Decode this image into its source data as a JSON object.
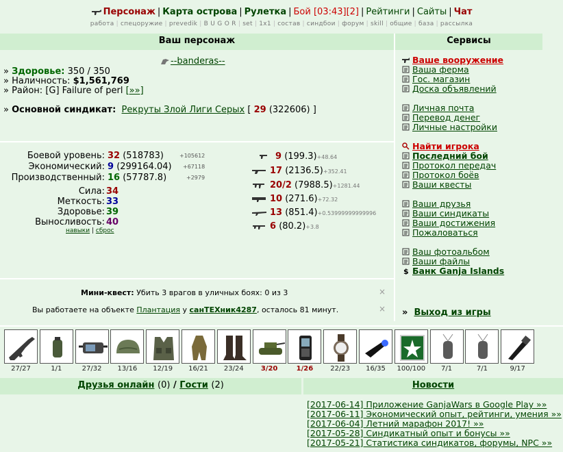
{
  "nav": {
    "items": [
      {
        "label": "Персонаж",
        "style": "red"
      },
      {
        "label": "Карта острова",
        "style": "normal"
      },
      {
        "label": "Рулетка",
        "style": "normal"
      },
      {
        "label": "Бой [03:43][2]",
        "style": "fight"
      },
      {
        "label": "Рейтинги",
        "style": "fightn"
      },
      {
        "label": "Сайты",
        "style": "fightn"
      },
      {
        "label": "Чат",
        "style": "red"
      }
    ],
    "sub": [
      "работа",
      "спецоружие",
      "prevedik",
      "B U G O R",
      "set",
      "1x1",
      "состав",
      "синдбои",
      "форум",
      "skill",
      "общие",
      "база",
      "рассылка"
    ]
  },
  "character": {
    "header": "Ваш персонаж",
    "nick": "--banderas--",
    "health_label": "Здоровье:",
    "health_value": "350 / 350",
    "cash_label": "Наличность:",
    "cash_value": "$1,561,769",
    "district_label": "Район:",
    "district_value": "[G] Failure of perl",
    "district_link": "[»»]",
    "syndicate_label": "Основной синдикат:",
    "syndicate_name": "Рекруты Злой Лиги Серых",
    "syndicate_open": "[",
    "syndicate_level": "29",
    "syndicate_points": "(322606)",
    "syndicate_close": "]"
  },
  "levels": [
    {
      "label": "Боевой уровень:",
      "value": "32",
      "extra": "(518783)",
      "delta": "+105612",
      "color": "red"
    },
    {
      "label": "Экономический:",
      "value": "9",
      "extra": "(299164.04)",
      "delta": "+67118",
      "color": "blue"
    },
    {
      "label": "Производственный:",
      "value": "16",
      "extra": "(57787.8)",
      "delta": "+2979",
      "color": "green"
    }
  ],
  "attributes": [
    {
      "label": "Сила:",
      "value": "34",
      "color": "red"
    },
    {
      "label": "Меткость:",
      "value": "33",
      "color": "blue"
    },
    {
      "label": "Здоровье:",
      "value": "39",
      "color": "green"
    },
    {
      "label": "Выносливость:",
      "value": "40",
      "color": "purple"
    }
  ],
  "attr_links": {
    "skills": "навыки",
    "reset": "сброс"
  },
  "weapons": [
    {
      "icon": "pistol-icon",
      "level": "9",
      "exp": "(199.3)",
      "delta": "+48.64"
    },
    {
      "icon": "shotgun-icon",
      "level": "17",
      "exp": "(2136.5)",
      "delta": "+352.41"
    },
    {
      "icon": "smg-icon",
      "level": "20/2",
      "exp": "(7988.5)",
      "delta": "+1281.44"
    },
    {
      "icon": "launcher-icon",
      "level": "10",
      "exp": "(271.6)",
      "delta": "+72.32"
    },
    {
      "icon": "sniper-icon",
      "level": "13",
      "exp": "(851.4)",
      "delta": "+0.53999999999996"
    },
    {
      "icon": "rifle-icon",
      "level": "6",
      "exp": "(80.2)",
      "delta": "+3.8"
    }
  ],
  "quest": {
    "mini_label": "Мини-квест:",
    "mini_text": "Убить 3 врагов в уличных боях: 0 из 3",
    "work_prefix": "Вы работаете на объекте",
    "work_object": "Плантация",
    "work_mid": "у",
    "work_owner": "санТЕХник4287",
    "work_suffix": ", осталось 81 минут.",
    "close": "×"
  },
  "services": {
    "header": "Сервисы",
    "items": [
      {
        "label": "Ваше вооружение",
        "icon": "gun-icon",
        "style": "red"
      },
      {
        "label": "Ваша ферма",
        "icon": "farm-icon",
        "style": ""
      },
      {
        "label": "Гос. магазин",
        "icon": "shop-icon",
        "style": ""
      },
      {
        "label": "Доска объявлений",
        "icon": "board-icon",
        "style": ""
      },
      {
        "label": "Личная почта",
        "icon": "mail-icon",
        "style": ""
      },
      {
        "label": "Перевод денег",
        "icon": "transfer-icon",
        "style": ""
      },
      {
        "label": "Личные настройки",
        "icon": "settings-icon",
        "style": ""
      },
      {
        "label": "Найти игрока",
        "icon": "search-icon",
        "style": "red"
      },
      {
        "label": "Последний бой",
        "icon": "battle-icon",
        "style": "bold"
      },
      {
        "label": "Протокол передач",
        "icon": "protocol-icon",
        "style": ""
      },
      {
        "label": "Протокол боёв",
        "icon": "battles-log-icon",
        "style": ""
      },
      {
        "label": "Ваши квесты",
        "icon": "quest-icon",
        "style": ""
      },
      {
        "label": "Ваши друзья",
        "icon": "friends-icon",
        "style": ""
      },
      {
        "label": "Ваши синдикаты",
        "icon": "syndicate-icon",
        "style": ""
      },
      {
        "label": "Ваши достижения",
        "icon": "achievements-icon",
        "style": ""
      },
      {
        "label": "Пожаловаться",
        "icon": "complain-icon",
        "style": ""
      },
      {
        "label": "Ваш фотоальбом",
        "icon": "photo-icon",
        "style": ""
      },
      {
        "label": "Ваши файлы",
        "icon": "files-icon",
        "style": ""
      },
      {
        "label": "Банк Ganja Islands",
        "icon": "dollar-icon",
        "style": "bold"
      }
    ],
    "exit_prefix": "»",
    "exit_label": "Выход из игры"
  },
  "inventory": [
    {
      "name": "rifle-slot",
      "cap": "27/27",
      "red": false
    },
    {
      "name": "grenade-slot",
      "cap": "1/1",
      "red": false
    },
    {
      "name": "pda-slot",
      "cap": "27/32",
      "red": false
    },
    {
      "name": "helmet-slot",
      "cap": "13/16",
      "red": false
    },
    {
      "name": "vest-slot",
      "cap": "12/19",
      "red": false
    },
    {
      "name": "ghillie-slot",
      "cap": "16/21",
      "red": false
    },
    {
      "name": "boots-slot",
      "cap": "23/24",
      "red": false
    },
    {
      "name": "tank-slot",
      "cap": "3/20",
      "red": true
    },
    {
      "name": "phone-slot",
      "cap": "1/26",
      "red": true
    },
    {
      "name": "watch-slot",
      "cap": "22/23",
      "red": false
    },
    {
      "name": "flashlight-slot",
      "cap": "16/35",
      "red": false
    },
    {
      "name": "badge-slot",
      "cap": "100/100",
      "red": false
    },
    {
      "name": "dogtag-slot-1",
      "cap": "7/1",
      "red": false
    },
    {
      "name": "dogtag-slot-2",
      "cap": "7/1",
      "red": false
    },
    {
      "name": "torch-slot",
      "cap": "9/17",
      "red": false
    }
  ],
  "friends": {
    "label": "Друзья онлайн",
    "count": "(0)",
    "sep": "/",
    "guests": "Гости",
    "guests_count": "(2)"
  },
  "news": {
    "header": "Новости",
    "items": [
      "[2017-06-14] Приложение GanjaWars в Google Play »»",
      "[2017-06-11] Экономический опыт, рейтинги, умения »»",
      "[2017-06-04] Летний марафон 2017! »»",
      "[2017-05-28] Синдикатный опыт и бонусы »»",
      "[2017-05-21] Статистика синдикатов, форумы, NPC »»"
    ]
  }
}
